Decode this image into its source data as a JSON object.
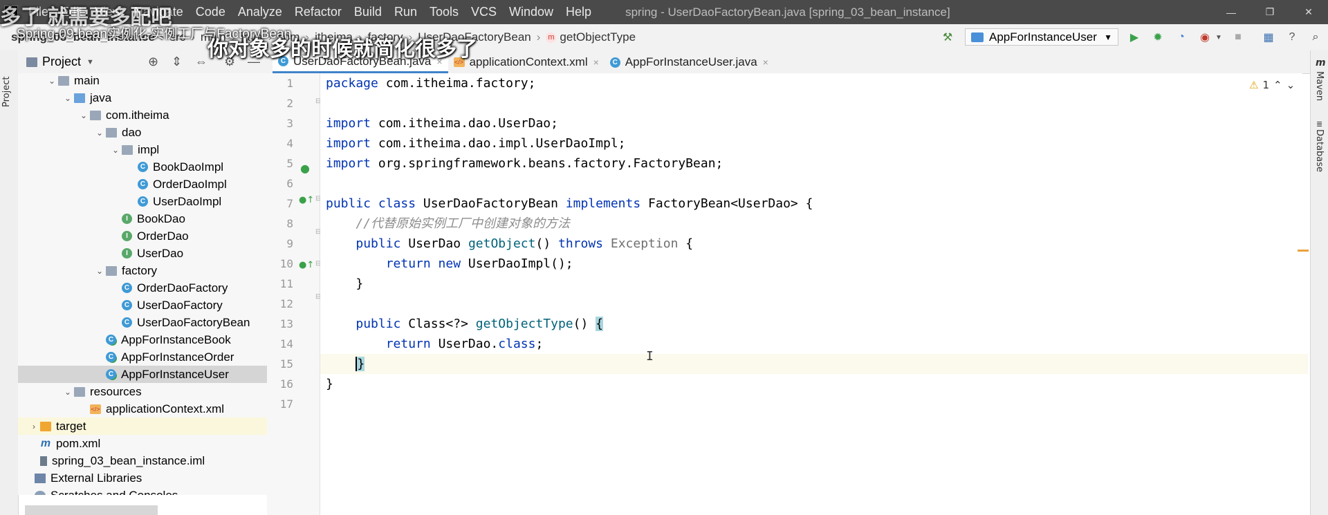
{
  "menu": [
    "File",
    "Edit",
    "View",
    "Navigate",
    "Code",
    "Analyze",
    "Refactor",
    "Build",
    "Run",
    "Tools",
    "VCS",
    "Window",
    "Help"
  ],
  "window_title": "spring - UserDaoFactoryBean.java [spring_03_bean_instance]",
  "window_buttons": [
    "—",
    "❐",
    "✕"
  ],
  "breadcrumb": {
    "project": "spring_03_bean_instance",
    "src": "src",
    "main": "main",
    "java": "java",
    "com": "com",
    "itheima": "itheima",
    "factory": "factory",
    "file": "UserDaoFactoryBean",
    "method": "getObjectType",
    "method_badge": "m"
  },
  "run_config": "AppForInstanceUser",
  "left_strip_label": "Project",
  "right_strip": {
    "maven": "Maven",
    "database": "Database",
    "maven_icon": "m"
  },
  "project_panel": {
    "title": "Project",
    "tree": [
      {
        "label": "main",
        "depth": 0,
        "arrow": "⌄",
        "icon": "folder"
      },
      {
        "label": "java",
        "depth": 1,
        "arrow": "⌄",
        "icon": "folder-blue"
      },
      {
        "label": "com.itheima",
        "depth": 2,
        "arrow": "⌄",
        "icon": "folder"
      },
      {
        "label": "dao",
        "depth": 3,
        "arrow": "⌄",
        "icon": "folder"
      },
      {
        "label": "impl",
        "depth": 4,
        "arrow": "⌄",
        "icon": "folder"
      },
      {
        "label": "BookDaoImpl",
        "depth": 5,
        "arrow": "",
        "icon": "class"
      },
      {
        "label": "OrderDaoImpl",
        "depth": 5,
        "arrow": "",
        "icon": "class"
      },
      {
        "label": "UserDaoImpl",
        "depth": 5,
        "arrow": "",
        "icon": "class"
      },
      {
        "label": "BookDao",
        "depth": 4,
        "arrow": "",
        "icon": "interface"
      },
      {
        "label": "OrderDao",
        "depth": 4,
        "arrow": "",
        "icon": "interface"
      },
      {
        "label": "UserDao",
        "depth": 4,
        "arrow": "",
        "icon": "interface"
      },
      {
        "label": "factory",
        "depth": 3,
        "arrow": "⌄",
        "icon": "folder"
      },
      {
        "label": "OrderDaoFactory",
        "depth": 4,
        "arrow": "",
        "icon": "class"
      },
      {
        "label": "UserDaoFactory",
        "depth": 4,
        "arrow": "",
        "icon": "class"
      },
      {
        "label": "UserDaoFactoryBean",
        "depth": 4,
        "arrow": "",
        "icon": "class"
      },
      {
        "label": "AppForInstanceBook",
        "depth": 3,
        "arrow": "",
        "icon": "class-run"
      },
      {
        "label": "AppForInstanceOrder",
        "depth": 3,
        "arrow": "",
        "icon": "class-run"
      },
      {
        "label": "AppForInstanceUser",
        "depth": 3,
        "arrow": "",
        "icon": "class-run",
        "selected": true
      },
      {
        "label": "resources",
        "depth": 1,
        "arrow": "⌄",
        "icon": "folder-res"
      },
      {
        "label": "applicationContext.xml",
        "depth": 2,
        "arrow": "",
        "icon": "xml"
      },
      {
        "label": "target",
        "depth": -1,
        "arrow": "›",
        "icon": "folder-orange",
        "target": true
      },
      {
        "label": "pom.xml",
        "depth": -1,
        "arrow": "",
        "icon": "maven"
      },
      {
        "label": "spring_03_bean_instance.iml",
        "depth": -1,
        "arrow": "",
        "icon": "iml"
      },
      {
        "label": "External Libraries",
        "depth": -2,
        "arrow": "",
        "icon": "libs"
      },
      {
        "label": "Scratches and Consoles",
        "depth": -2,
        "arrow": "",
        "icon": "scratch"
      }
    ]
  },
  "tabs": [
    {
      "label": "UserDaoFactoryBean.java",
      "icon": "class",
      "active": true,
      "close": "×"
    },
    {
      "label": "applicationContext.xml",
      "icon": "xml",
      "active": false,
      "close": "×"
    },
    {
      "label": "AppForInstanceUser.java",
      "icon": "class",
      "active": false,
      "close": "×"
    }
  ],
  "editor": {
    "warnings": "1",
    "line_numbers": [
      "1",
      "2",
      "3",
      "4",
      "5",
      "6",
      "7",
      "8",
      "9",
      "10",
      "11",
      "12",
      "13",
      "14",
      "15",
      "16",
      "17"
    ],
    "current_line": 15
  },
  "subtitles": {
    "top_left": "Spring-09-bean实例化-实例工厂与FactoryBean",
    "caption": "你对象多的时候就简化很多了",
    "ghost": "多了 就需要多配吧"
  }
}
